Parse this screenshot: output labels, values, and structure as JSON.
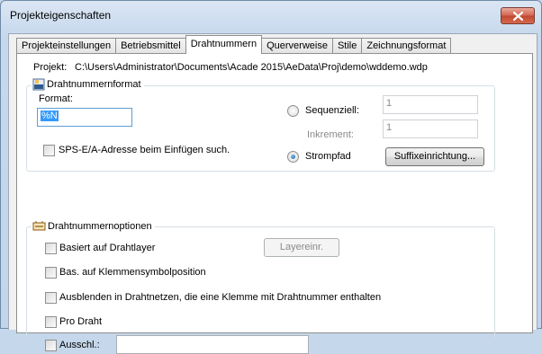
{
  "window": {
    "title": "Projekteigenschaften"
  },
  "tabs": [
    {
      "label": "Projekteinstellungen",
      "active": false
    },
    {
      "label": "Betriebsmittel",
      "active": false
    },
    {
      "label": "Drahtnummern",
      "active": true
    },
    {
      "label": "Querverweise",
      "active": false
    },
    {
      "label": "Stile",
      "active": false
    },
    {
      "label": "Zeichnungsformat",
      "active": false
    }
  ],
  "project": {
    "label": "Projekt:",
    "path": "C:\\Users\\Administrator\\Documents\\Acade 2015\\AeData\\Proj\\demo\\wddemo.wdp"
  },
  "format_group": {
    "title": "Drahtnummernformat",
    "format_label": "Format:",
    "format_value": "%N",
    "sps_checkbox": {
      "label": "SPS-E/A-Adresse beim Einfügen such.",
      "checked": false
    },
    "sequential": {
      "label": "Sequenziell:",
      "value": "1",
      "selected": false
    },
    "increment": {
      "label": "Inkrement:",
      "value": "1"
    },
    "strompfad": {
      "label": "Strompfad",
      "selected": true
    },
    "suffix_button": "Suffixeinrichtung..."
  },
  "options_group": {
    "title": "Drahtnummernoptionen",
    "items": [
      {
        "label": "Basiert auf Drahtlayer",
        "checked": false
      },
      {
        "label": "Bas. auf Klemmensymbolposition",
        "checked": false
      },
      {
        "label": "Ausblenden in Drahtnetzen, die eine Klemme mit Drahtnummer enthalten",
        "checked": false
      },
      {
        "label": "Pro Draht",
        "checked": false
      },
      {
        "label": "Ausschl.:",
        "checked": false
      }
    ],
    "layer_button": "Layereinr.",
    "exclude_value": ""
  }
}
